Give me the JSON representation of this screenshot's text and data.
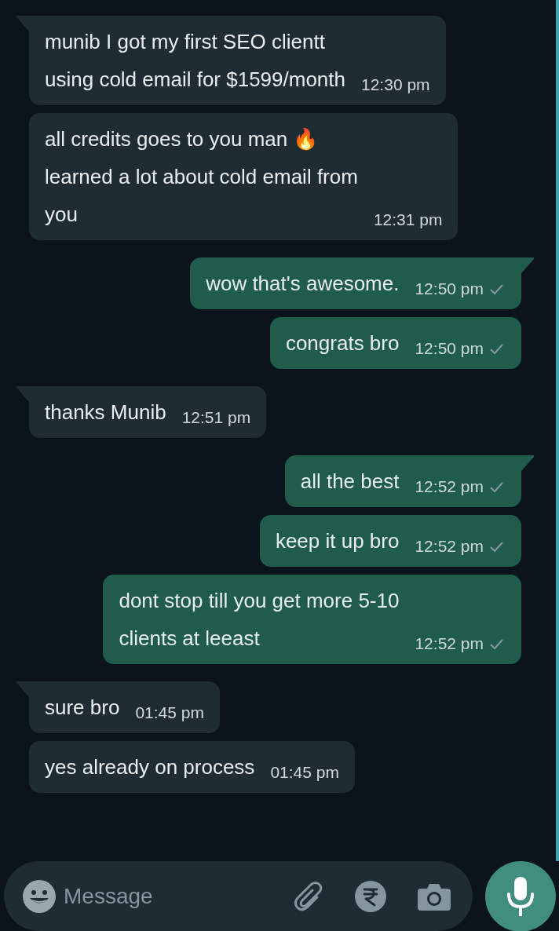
{
  "messages": [
    {
      "kind": "incoming",
      "tail": true,
      "text": "munib I got my first SEO clientt\nusing cold email for $1599/month",
      "time": "12:30 pm"
    },
    {
      "kind": "incoming",
      "tail": false,
      "text": "all credits goes to you man 🔥\nlearned a lot about cold email from\nyou",
      "time": "12:31 pm"
    },
    {
      "kind": "outgoing",
      "tail": true,
      "text": "wow that's awesome.",
      "time": "12:50 pm",
      "sent": true
    },
    {
      "kind": "outgoing",
      "tail": false,
      "text": "congrats bro",
      "time": "12:50 pm",
      "sent": true
    },
    {
      "kind": "incoming",
      "tail": true,
      "text": "thanks Munib",
      "time": "12:51 pm"
    },
    {
      "kind": "outgoing",
      "tail": true,
      "text": "all the best",
      "time": "12:52 pm",
      "sent": true
    },
    {
      "kind": "outgoing",
      "tail": false,
      "text": "keep it up bro",
      "time": "12:52 pm",
      "sent": true
    },
    {
      "kind": "outgoing",
      "tail": false,
      "text": "dont stop till you get more 5-10\nclients at leeast",
      "time": "12:52 pm",
      "sent": true
    },
    {
      "kind": "incoming",
      "tail": true,
      "text": "sure bro",
      "time": "01:45 pm"
    },
    {
      "kind": "incoming",
      "tail": false,
      "text": "yes already on process",
      "time": "01:45 pm"
    }
  ],
  "compose": {
    "placeholder": "Message"
  }
}
